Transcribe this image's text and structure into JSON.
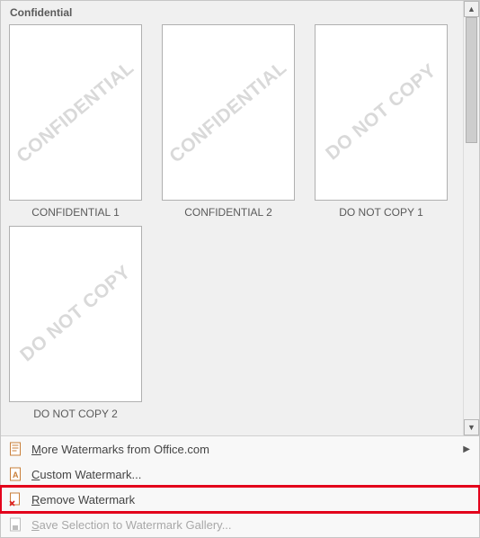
{
  "section": {
    "title": "Confidential"
  },
  "thumbs": [
    {
      "watermark": "CONFIDENTIAL",
      "label": "CONFIDENTIAL 1"
    },
    {
      "watermark": "CONFIDENTIAL",
      "label": "CONFIDENTIAL 2"
    },
    {
      "watermark": "DO NOT COPY",
      "label": "DO NOT COPY 1"
    },
    {
      "watermark": "DO NOT COPY",
      "label": "DO NOT COPY 2"
    }
  ],
  "menu": {
    "more": "More Watermarks from Office.com",
    "custom": "Custom Watermark...",
    "remove": "Remove Watermark",
    "save": "Save Selection to Watermark Gallery..."
  },
  "scroll": {
    "up": "▲",
    "down": "▼"
  }
}
